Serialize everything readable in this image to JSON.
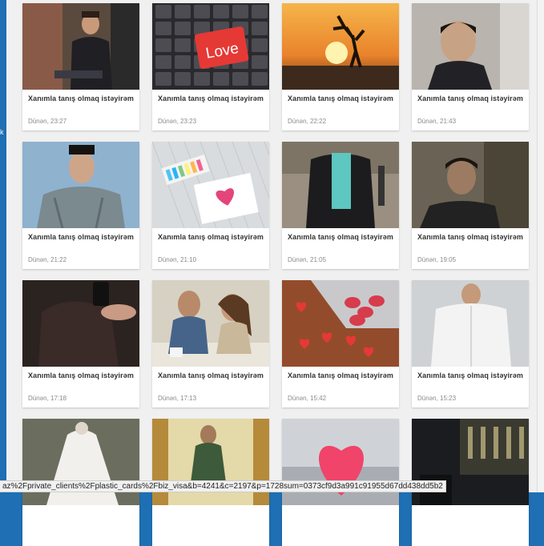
{
  "listing": {
    "cards": [
      {
        "title": "Xanımla tanış olmaq istəyirəm",
        "time": "Dünən, 23:27",
        "image": "man-seated-photo"
      },
      {
        "title": "Xanımla tanış olmaq istəyirəm",
        "time": "Dünən, 23:23",
        "image": "love-keyboard-photo",
        "key_text": "Love"
      },
      {
        "title": "Xanımla tanış olmaq istəyirəm",
        "time": "Dünən, 22:22",
        "image": "sunset-couple-photo"
      },
      {
        "title": "Xanımla tanış olmaq istəyirəm",
        "time": "Dünən, 21:43",
        "image": "man-selfie-photo"
      },
      {
        "title": "Xanımla tanış olmaq istəyirəm",
        "time": "Dünən, 21:22",
        "image": "man-uniform-photo"
      },
      {
        "title": "Xanımla tanış olmaq istəyirəm",
        "time": "Dünən, 21:10",
        "image": "heart-drawing-photo"
      },
      {
        "title": "Xanımla tanış olmaq istəyirəm",
        "time": "Dünən, 21:05",
        "image": "man-suit-photo"
      },
      {
        "title": "Xanımla tanış olmaq istəyirəm",
        "time": "Dünən, 19:05",
        "image": "man-outdoor-photo"
      },
      {
        "title": "Xanımla tanış olmaq istəyirəm",
        "time": "Dünən, 17:18",
        "image": "mirror-selfie-photo"
      },
      {
        "title": "Xanımla tanış olmaq istəyirəm",
        "time": "Dünən, 17:13",
        "image": "couple-cafe-photo"
      },
      {
        "title": "Xanımla tanış olmaq istəyirəm",
        "time": "Dünən, 15:42",
        "image": "hearts-laptop-photo"
      },
      {
        "title": "Xanımla tanış olmaq istəyirəm",
        "time": "Dünən, 15:23",
        "image": "man-white-shirt-photo"
      },
      {
        "title": "",
        "time": "",
        "image": "wedding-dress-photo"
      },
      {
        "title": "",
        "time": "",
        "image": "man-bench-photo"
      },
      {
        "title": "",
        "time": "",
        "image": "heart-keyboard-photo"
      },
      {
        "title": "",
        "time": "",
        "image": "night-street-photo"
      }
    ]
  },
  "edge_mark": "k",
  "status_bar": {
    "url": "az%2Fprivate_clients%2Fplastic_cards%2Fbiz_visa&b=4241&c=2197&p=1728sum=0373cf9d3a991c91955d67dd438dd5b2"
  },
  "colors": {
    "desktop": "#1e6fb3",
    "panel": "#f0f0f0",
    "card": "#ffffff",
    "title": "#333333",
    "time": "#8a8a8a",
    "love_key": "#e53935"
  }
}
